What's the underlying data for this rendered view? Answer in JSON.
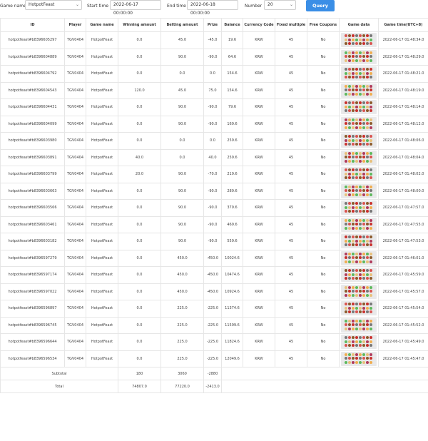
{
  "toolbar": {
    "game_name_label": "Game name",
    "game_name_value": "HotpotFeast",
    "start_time_label": "Start time",
    "start_time_value": "2022-06-17 00:00:00",
    "end_time_label": "End time",
    "end_time_value": "2022-06-18 00:00:00",
    "number_label": "Number",
    "number_value": "20",
    "query_label": "Query"
  },
  "table": {
    "headers": {
      "id": "ID",
      "player": "Player",
      "game_name": "Game name",
      "winning": "Winning amount",
      "betting": "Betting amount",
      "prize": "Prize",
      "balance": "Balance",
      "currency": "Currency Code",
      "multiple": "Fixed multiple",
      "coupons": "Free Coupons",
      "game_data": "Game data",
      "game_time": "Game time(UTC+8)"
    },
    "rows": [
      {
        "id": "hotpotfeast#b8396605297",
        "player": "TGV0404",
        "game": "HotpotFeast",
        "win": "0.0",
        "bet": "45.0",
        "prize": "-45.0",
        "balance": "19.6",
        "currency": "KRW",
        "multiple": "45",
        "coupons": "No",
        "time": "2022-06-17 01:48:34.0"
      },
      {
        "id": "hotpotfeast#b8396604889",
        "player": "TGV0404",
        "game": "HotpotFeast",
        "win": "0.0",
        "bet": "90.0",
        "prize": "-90.0",
        "balance": "64.6",
        "currency": "KRW",
        "multiple": "45",
        "coupons": "No",
        "time": "2022-06-17 01:48:29.0"
      },
      {
        "id": "hotpotfeast#b8396604792",
        "player": "TGV0404",
        "game": "HotpotFeast",
        "win": "0.0",
        "bet": "0.0",
        "prize": "0.0",
        "balance": "154.6",
        "currency": "KRW",
        "multiple": "45",
        "coupons": "No",
        "time": "2022-06-17 01:48:21.0"
      },
      {
        "id": "hotpotfeast#b8396604543",
        "player": "TGV0404",
        "game": "HotpotFeast",
        "win": "120.0",
        "bet": "45.0",
        "prize": "75.0",
        "balance": "154.6",
        "currency": "KRW",
        "multiple": "45",
        "coupons": "No",
        "time": "2022-06-17 01:48:19.0"
      },
      {
        "id": "hotpotfeast#b8396604431",
        "player": "TGV0404",
        "game": "HotpotFeast",
        "win": "0.0",
        "bet": "90.0",
        "prize": "-90.0",
        "balance": "79.6",
        "currency": "KRW",
        "multiple": "45",
        "coupons": "No",
        "time": "2022-06-17 01:48:14.0"
      },
      {
        "id": "hotpotfeast#b8396604099",
        "player": "TGV0404",
        "game": "HotpotFeast",
        "win": "0.0",
        "bet": "90.0",
        "prize": "-90.0",
        "balance": "169.6",
        "currency": "KRW",
        "multiple": "45",
        "coupons": "No",
        "time": "2022-06-17 01:48:12.0"
      },
      {
        "id": "hotpotfeast#b8396603980",
        "player": "TGV0404",
        "game": "HotpotFeast",
        "win": "0.0",
        "bet": "0.0",
        "prize": "0.0",
        "balance": "259.6",
        "currency": "KRW",
        "multiple": "45",
        "coupons": "No",
        "time": "2022-06-17 01:48:06.0"
      },
      {
        "id": "hotpotfeast#b8396603891",
        "player": "TGV0404",
        "game": "HotpotFeast",
        "win": "40.0",
        "bet": "0.0",
        "prize": "40.0",
        "balance": "259.6",
        "currency": "KRW",
        "multiple": "45",
        "coupons": "No",
        "time": "2022-06-17 01:48:04.0"
      },
      {
        "id": "hotpotfeast#b8396603799",
        "player": "TGV0404",
        "game": "HotpotFeast",
        "win": "20.0",
        "bet": "90.0",
        "prize": "-70.0",
        "balance": "219.6",
        "currency": "KRW",
        "multiple": "45",
        "coupons": "No",
        "time": "2022-06-17 01:48:02.0"
      },
      {
        "id": "hotpotfeast#b8396603663",
        "player": "TGV0404",
        "game": "HotpotFeast",
        "win": "0.0",
        "bet": "90.0",
        "prize": "-90.0",
        "balance": "289.6",
        "currency": "KRW",
        "multiple": "45",
        "coupons": "No",
        "time": "2022-06-17 01:48:00.0"
      },
      {
        "id": "hotpotfeast#b8396603566",
        "player": "TGV0404",
        "game": "HotpotFeast",
        "win": "0.0",
        "bet": "90.0",
        "prize": "-90.0",
        "balance": "379.6",
        "currency": "KRW",
        "multiple": "45",
        "coupons": "No",
        "time": "2022-06-17 01:47:57.0"
      },
      {
        "id": "hotpotfeast#b8396603461",
        "player": "TGV0404",
        "game": "HotpotFeast",
        "win": "0.0",
        "bet": "90.0",
        "prize": "-90.0",
        "balance": "469.6",
        "currency": "KRW",
        "multiple": "45",
        "coupons": "No",
        "time": "2022-06-17 01:47:55.0"
      },
      {
        "id": "hotpotfeast#b8396603182",
        "player": "TGV0404",
        "game": "HotpotFeast",
        "win": "0.0",
        "bet": "90.0",
        "prize": "-90.0",
        "balance": "559.6",
        "currency": "KRW",
        "multiple": "45",
        "coupons": "No",
        "time": "2022-06-17 01:47:53.0"
      },
      {
        "id": "hotpotfeast#b8396597279",
        "player": "TGV0404",
        "game": "HotpotFeast",
        "win": "0.0",
        "bet": "450.0",
        "prize": "-450.0",
        "balance": "10024.6",
        "currency": "KRW",
        "multiple": "45",
        "coupons": "No",
        "time": "2022-06-17 01:46:01.0"
      },
      {
        "id": "hotpotfeast#b8396597174",
        "player": "TGV0404",
        "game": "HotpotFeast",
        "win": "0.0",
        "bet": "450.0",
        "prize": "-450.0",
        "balance": "10474.6",
        "currency": "KRW",
        "multiple": "45",
        "coupons": "No",
        "time": "2022-06-17 01:45:59.0"
      },
      {
        "id": "hotpotfeast#b8396597022",
        "player": "TGV0404",
        "game": "HotpotFeast",
        "win": "0.0",
        "bet": "450.0",
        "prize": "-450.0",
        "balance": "10924.6",
        "currency": "KRW",
        "multiple": "45",
        "coupons": "No",
        "time": "2022-06-17 01:45:57.0"
      },
      {
        "id": "hotpotfeast#b8396596897",
        "player": "TGV0404",
        "game": "HotpotFeast",
        "win": "0.0",
        "bet": "225.0",
        "prize": "-225.0",
        "balance": "11374.6",
        "currency": "KRW",
        "multiple": "45",
        "coupons": "No",
        "time": "2022-06-17 01:45:54.0"
      },
      {
        "id": "hotpotfeast#b8396596745",
        "player": "TGV0404",
        "game": "HotpotFeast",
        "win": "0.0",
        "bet": "225.0",
        "prize": "-225.0",
        "balance": "11599.6",
        "currency": "KRW",
        "multiple": "45",
        "coupons": "No",
        "time": "2022-06-17 01:45:52.0"
      },
      {
        "id": "hotpotfeast#b8396596644",
        "player": "TGV0404",
        "game": "HotpotFeast",
        "win": "0.0",
        "bet": "225.0",
        "prize": "-225.0",
        "balance": "11824.6",
        "currency": "KRW",
        "multiple": "45",
        "coupons": "No",
        "time": "2022-06-17 01:45:49.0"
      },
      {
        "id": "hotpotfeast#b8396596534",
        "player": "TGV0404",
        "game": "HotpotFeast",
        "win": "0.0",
        "bet": "225.0",
        "prize": "-225.0",
        "balance": "12049.6",
        "currency": "KRW",
        "multiple": "45",
        "coupons": "No",
        "time": "2022-06-17 01:45:47.0"
      }
    ],
    "subtotal": {
      "label": "Subtotal",
      "win": "180",
      "bet": "3060",
      "prize": "-2880"
    },
    "total": {
      "label": "Total",
      "win": "74807.0",
      "bet": "77220.0",
      "prize": "-2413.0"
    }
  },
  "symbol_colors": [
    "#d9534f",
    "#f0ad4e",
    "#8b5a2b",
    "#5cb85c",
    "#c9302c",
    "#e8c07a",
    "#777777",
    "#b03a5b"
  ],
  "colors": {
    "query_button": "#3a8ee6",
    "game_data_bg": "#e9e9ea"
  }
}
